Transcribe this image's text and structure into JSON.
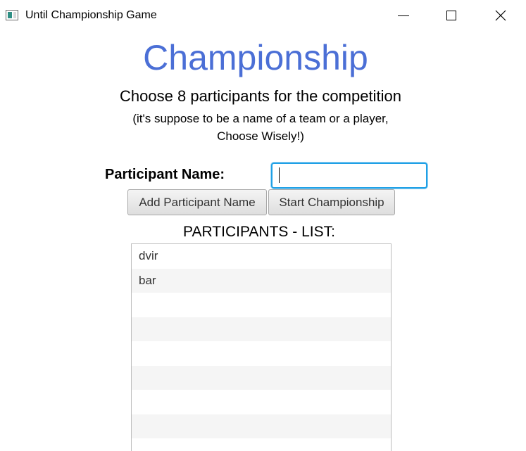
{
  "window": {
    "title": "Until Championship Game",
    "icon": "app-window-icon",
    "controls": {
      "minimize_icon": "minimize-icon",
      "maximize_icon": "maximize-icon",
      "close_icon": "close-icon"
    }
  },
  "main": {
    "heading": "Championship",
    "instruction_line1": "Choose 8 participants for the competition",
    "instruction_line2": "(it's suppose to be a name of a team or a player,",
    "instruction_line3": "Choose Wisely!)",
    "participant_label": "Participant Name:",
    "participant_input": {
      "value": "",
      "placeholder": ""
    },
    "add_button_label": "Add Participant Name",
    "start_button_label": "Start Championship",
    "list_label": "PARTICIPANTS - LIST:",
    "participants": [
      "dvir",
      "bar",
      "",
      "",
      "",
      "",
      "",
      "",
      ""
    ]
  },
  "colors": {
    "heading": "#4b6fd6",
    "input_focus": "#1fa0e6"
  }
}
